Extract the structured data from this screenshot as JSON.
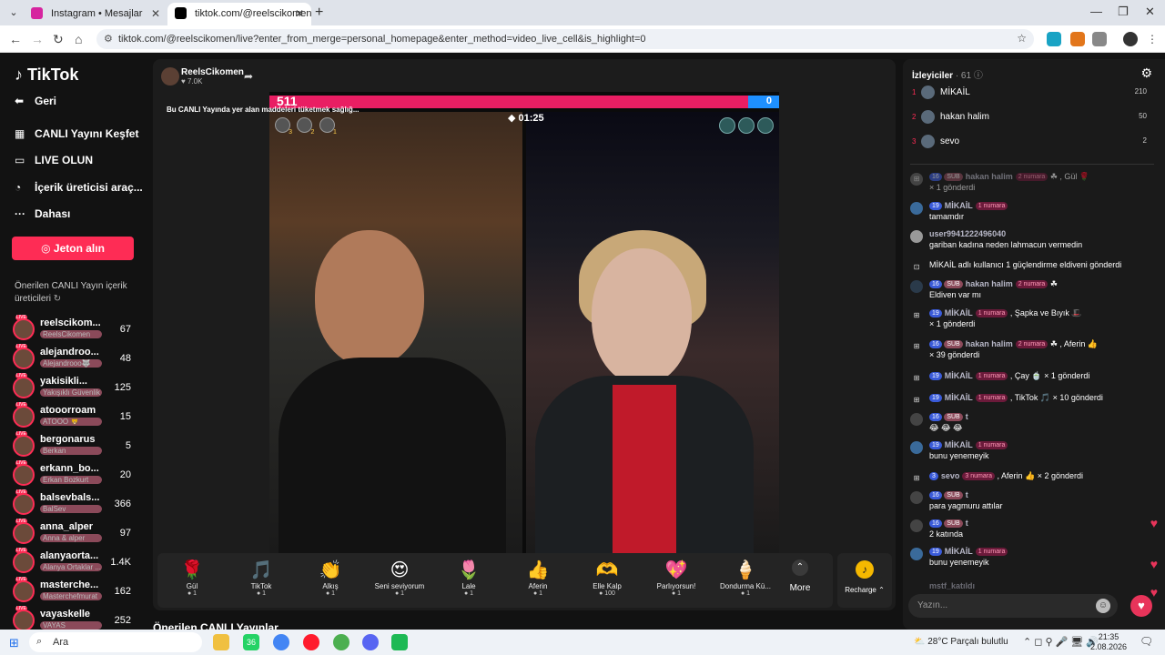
{
  "browser": {
    "tabs": [
      {
        "title": "Instagram • Mesajlar",
        "color": "#d6249f"
      },
      {
        "title": "tiktok.com/@reelscikomen/",
        "color": "#000000"
      }
    ],
    "url": "tiktok.com/@reelscikomen/live?enter_from_merge=personal_homepage&enter_method=video_live_cell&is_highlight=0"
  },
  "sidebar": {
    "logo": "TikTok",
    "nav": [
      {
        "label": "Geri",
        "icon": "arrow-left-icon"
      },
      {
        "label": "CANLI Yayını Keşfet",
        "icon": "grid-icon"
      },
      {
        "label": "LIVE OLUN",
        "icon": "camera-icon"
      },
      {
        "label": "İçerik üreticisi araç...",
        "icon": "lightbulb-icon"
      },
      {
        "label": "Dahası",
        "icon": "more-icon"
      }
    ],
    "jeton_label": "Jeton alın",
    "suggested_title": "Önerilen CANLI Yayın içerik üreticileri",
    "creators": [
      {
        "name": "reelscikom...",
        "sub": "ReelsCikomen",
        "count": "67"
      },
      {
        "name": "alejandroo...",
        "sub": "Alejandrooo🐺",
        "count": "48"
      },
      {
        "name": "yakisikli...",
        "sub": "Yakışıklı Güvenlik",
        "count": "125"
      },
      {
        "name": "atooorroam",
        "sub": "ATOOO 🦁",
        "count": "15"
      },
      {
        "name": "bergonarus",
        "sub": "Berkan",
        "count": "5"
      },
      {
        "name": "erkann_bo...",
        "sub": "Erkan Bozkurt",
        "count": "20"
      },
      {
        "name": "balsevbals...",
        "sub": "BalSev",
        "count": "366"
      },
      {
        "name": "anna_alper",
        "sub": "Anna & alper",
        "count": "97"
      },
      {
        "name": "alanyaorta...",
        "sub": "Alanya Ortaklar ...",
        "count": "1.4K"
      },
      {
        "name": "masterche...",
        "sub": "Masterchefmurat",
        "count": "162"
      },
      {
        "name": "vayaskelle",
        "sub": "VAYAS",
        "count": "252"
      }
    ]
  },
  "stream": {
    "host_name": "ReelsCikomen",
    "host_likes": "♥ 7.0K",
    "promo_text": "Bu CANLI Yayında yer alan maddeleri tüketmek sağlığ...",
    "pk_left_score": "511",
    "pk_right_score": "0",
    "pk_left_fraction": 0.94,
    "timer": "01:25",
    "gifter_ranks": [
      "3",
      "2",
      "1"
    ]
  },
  "gifts": [
    {
      "name": "Gül",
      "icon": "🌹",
      "price": "1"
    },
    {
      "name": "TikTok",
      "icon": "🎵",
      "price": "1"
    },
    {
      "name": "Alkış",
      "icon": "👏",
      "price": "1"
    },
    {
      "name": "Seni seviyorum",
      "icon": "😍",
      "price": "1"
    },
    {
      "name": "Lale",
      "icon": "🌷",
      "price": "1"
    },
    {
      "name": "Aferin",
      "icon": "👍",
      "price": "1"
    },
    {
      "name": "Elle Kalp",
      "icon": "🫶",
      "price": "100"
    },
    {
      "name": "Parlıyorsun!",
      "icon": "💖",
      "price": "1"
    },
    {
      "name": "Dondurma Kü...",
      "icon": "🍦",
      "price": "1"
    }
  ],
  "more_label": "More",
  "recharge_label": "Recharge",
  "suggested_live": "Önerilen CANLI Yayınlar",
  "viewers": {
    "title": "İzleyiciler",
    "count": "· 61",
    "top": [
      {
        "rank": "1",
        "name": "MİKAİL",
        "score": "210"
      },
      {
        "rank": "2",
        "name": "hakan halim",
        "score": "50"
      },
      {
        "rank": "3",
        "name": "sevo",
        "score": "2"
      }
    ]
  },
  "chat": [
    {
      "level": "16",
      "sub": "SUB",
      "user": "hakan halim",
      "num": "2 numara",
      "text": "☘ , Gül 🌹",
      "line2": "× 1 gönderdi"
    },
    {
      "level": "19",
      "user": "MİKAİL",
      "num": "1 numara",
      "line2": "tamamdır"
    },
    {
      "user": "user9941222496040",
      "line2": "gariban kadına neden lahmacun vermedin"
    },
    {
      "system": "MİKAİL adlı kullanıcı 1 güçlendirme eldiveni gönderdi"
    },
    {
      "level": "16",
      "sub": "SUB",
      "user": "hakan halim",
      "num": "2 numara",
      "text": "☘",
      "line2": "Eldiven var mı"
    },
    {
      "level": "19",
      "user": "MİKAİL",
      "num": "1 numara",
      "text": ", Şapka ve Bıyık 🎩",
      "line2": "× 1 gönderdi"
    },
    {
      "level": "16",
      "sub": "SUB",
      "user": "hakan halim",
      "num": "2 numara",
      "text": "☘ , Aferin 👍",
      "line2": "× 39 gönderdi"
    },
    {
      "level": "19",
      "user": "MİKAİL",
      "num": "1 numara",
      "text": ", Çay 🍵 × 1 gönderdi"
    },
    {
      "level": "19",
      "user": "MİKAİL",
      "num": "1 numara",
      "text": ", TikTok 🎵 × 10 gönderdi"
    },
    {
      "level": "16",
      "sub": "SUB",
      "user": "t",
      "line2": "😂 😂 😂"
    },
    {
      "level": "19",
      "user": "MİKAİL",
      "num": "1 numara",
      "line2": "bunu yenemeyik"
    },
    {
      "level": "3",
      "user": "sevo",
      "num": "3 numara",
      "text": ", Aferin 👍 × 2 gönderdi"
    },
    {
      "level": "16",
      "sub": "SUB",
      "user": "t",
      "line2": "para yagmuru attılar"
    },
    {
      "level": "16",
      "sub": "SUB",
      "user": "t",
      "line2": "2 katında"
    },
    {
      "level": "19",
      "user": "MİKAİL",
      "num": "1 numara",
      "line2": "bunu yenemeyik"
    },
    {
      "user": "mstf_katıldı"
    }
  ],
  "chat_placeholder": "Yazın...",
  "taskbar": {
    "search_label": "Ara",
    "weather": "28°C  Parçalı bulutlu",
    "time": "21:35",
    "date": "2.08.2026",
    "whatsapp_badge": "36"
  }
}
